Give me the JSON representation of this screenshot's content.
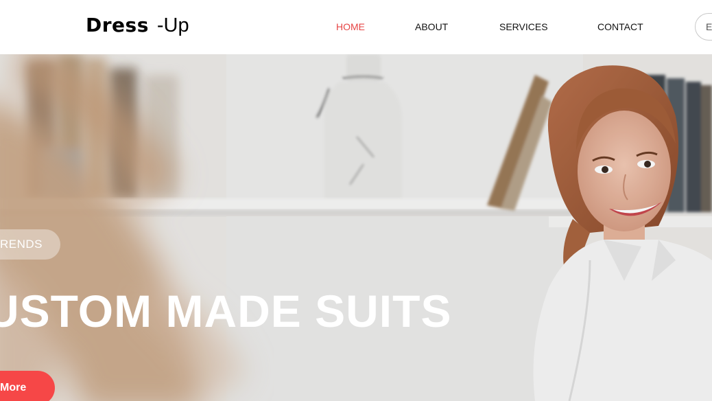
{
  "header": {
    "logo_bold": "Dress",
    "logo_light": "-Up",
    "nav": [
      {
        "label": "HOME",
        "active": true
      },
      {
        "label": "ABOUT",
        "active": false
      },
      {
        "label": "SERVICES",
        "active": false
      },
      {
        "label": "CONTACT",
        "active": false
      }
    ],
    "button_label": "E"
  },
  "hero": {
    "tag": "RENDS",
    "title": "USTOM MADE SUITS",
    "button_label": "More"
  },
  "colors": {
    "accent": "#f64747",
    "nav_active": "#e64545",
    "text": "#111111"
  }
}
